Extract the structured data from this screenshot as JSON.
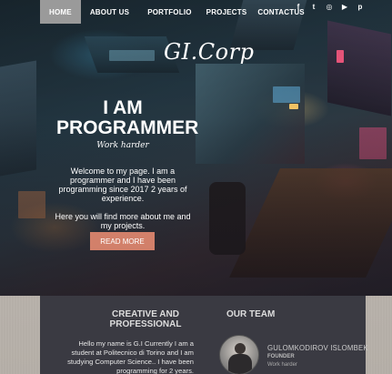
{
  "nav": {
    "items": [
      {
        "label": "HOME",
        "active": true
      },
      {
        "label": "ABOUT US",
        "active": false
      },
      {
        "label": "PORTFOLIO",
        "active": false
      },
      {
        "label": "PROJECTS",
        "active": false
      },
      {
        "label": "CONTACTUS",
        "active": false
      }
    ]
  },
  "social": [
    {
      "icon": "facebook-icon",
      "glyph": "f"
    },
    {
      "icon": "twitter-icon",
      "glyph": "t"
    },
    {
      "icon": "instagram-icon",
      "glyph": "◎"
    },
    {
      "icon": "youtube-icon",
      "glyph": "▶"
    },
    {
      "icon": "pinterest-icon",
      "glyph": "p"
    }
  ],
  "hero": {
    "logo": "GI.Corp",
    "headline_1": "I AM",
    "headline_2": "PROGRAMMER",
    "tagline": "Work harder",
    "intro_1": "Welcome to my page. I am a programmer and I have been programming since 2017 2 years of experience.",
    "intro_2": "Here you will find more about me and my projects.",
    "read_more": "READ MORE"
  },
  "about": {
    "title": "CREATIVE AND PROFESSIONAL",
    "text": "Hello my name is G.I Currently I am a student at Politecnico di Torino and I am studying Computer Science.. I have been programming for 2 years."
  },
  "team": {
    "title": "OUR TEAM",
    "member_name": "GULOMKODIROV ISLOMBEK",
    "member_role": "FOUNDER",
    "member_motto": "Work harder"
  },
  "colors": {
    "accent": "#d2806a",
    "panel": "#3a3a42",
    "nav_active": "#9a9a9a"
  }
}
